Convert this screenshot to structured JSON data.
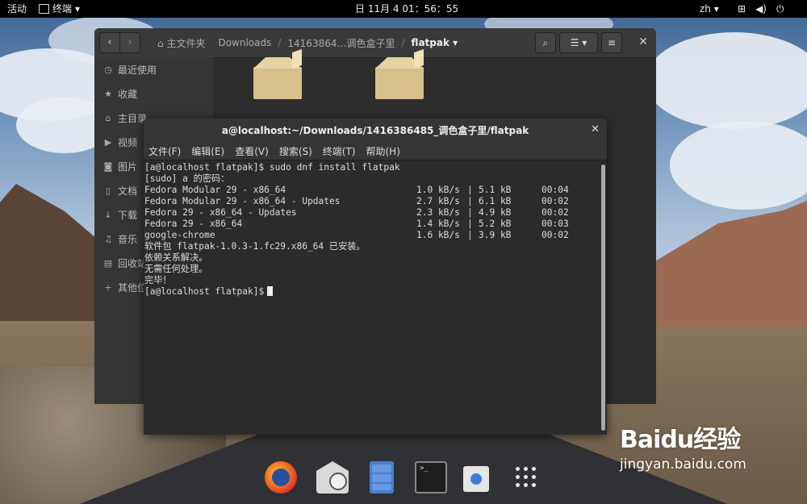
{
  "topbar": {
    "activities": "活动",
    "app_name": "终端",
    "clock": "日 11月 4  01：56：55",
    "language": "zh",
    "icons": [
      "network-icon",
      "volume-icon",
      "power-icon"
    ]
  },
  "files": {
    "breadcrumbs": [
      "主文件夹",
      "Downloads",
      "14163864…调色盒子里",
      "flatpak"
    ],
    "sidebar": [
      "最近使用",
      "收藏",
      "主目录",
      "视频",
      "图片",
      "文档",
      "下载",
      "音乐",
      "回收站",
      "其他位置"
    ],
    "sidebar_icons": [
      "clock-icon",
      "star-icon",
      "home-icon",
      "video-icon",
      "camera-icon",
      "document-icon",
      "download-icon",
      "music-icon",
      "trash-icon",
      "plus-icon"
    ]
  },
  "terminal": {
    "title": "a@localhost:~/Downloads/1416386485_调色盒子里/flatpak",
    "menu": [
      "文件(F)",
      "编辑(E)",
      "查看(V)",
      "搜索(S)",
      "终端(T)",
      "帮助(H)"
    ],
    "line_cmd": "[a@localhost flatpak]$ sudo dnf install flatpak",
    "line_sudo": "[sudo] a 的密码：",
    "repos": [
      {
        "name": "Fedora Modular 29 - x86_64",
        "rate": "1.0 kB/s",
        "size": "5.1 kB",
        "time": "00:04"
      },
      {
        "name": "Fedora Modular 29 - x86_64 - Updates",
        "rate": "2.7 kB/s",
        "size": "6.1 kB",
        "time": "00:02"
      },
      {
        "name": "Fedora 29 - x86_64 - Updates",
        "rate": "2.3 kB/s",
        "size": "4.9 kB",
        "time": "00:02"
      },
      {
        "name": "Fedora 29 - x86_64",
        "rate": "1.4 kB/s",
        "size": "5.2 kB",
        "time": "00:03"
      },
      {
        "name": "google-chrome",
        "rate": "1.6 kB/s",
        "size": "3.9 kB",
        "time": "00:02"
      }
    ],
    "line_installed": "软件包 flatpak-1.0.3-1.fc29.x86_64 已安装。",
    "line_deps": "依赖关系解决。",
    "line_noop": "无需任何处理。",
    "line_done": "完毕！",
    "prompt": "[a@localhost flatpak]$"
  },
  "dock": [
    "firefox-icon",
    "evolution-icon",
    "files-icon",
    "terminal-icon",
    "software-icon",
    "show-apps-icon"
  ],
  "watermark": {
    "main": "Baidu经验",
    "sub": "jingyan.baidu.com"
  }
}
